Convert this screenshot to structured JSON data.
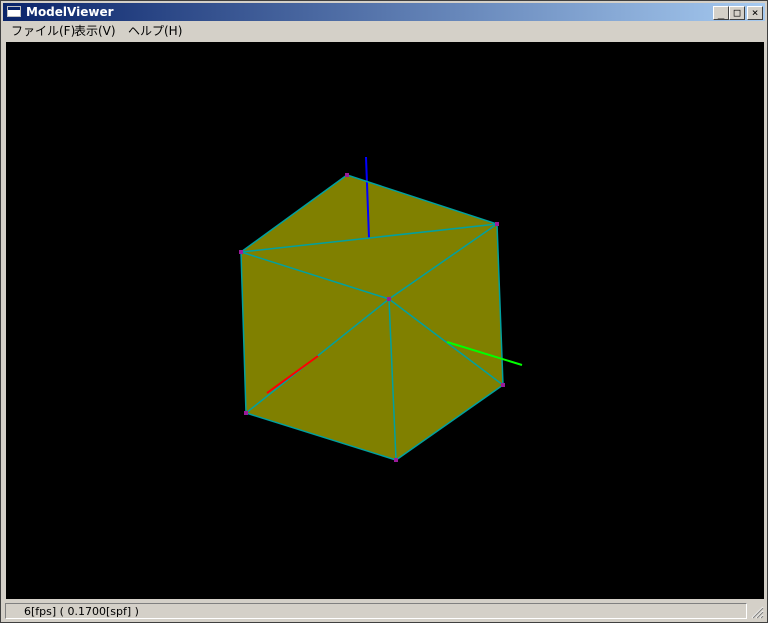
{
  "window": {
    "title": "ModelViewer"
  },
  "controls": {
    "minimize": "_",
    "maximize": "□",
    "close": "×"
  },
  "menu": {
    "file": "ファイル(F)",
    "view": "表示(V)",
    "help": "ヘルプ(H)"
  },
  "viewport": {
    "background": "#000000",
    "face_color": "#808000",
    "edge_color": "#00a0a0",
    "vertex_color": "#9a1a9a",
    "axis_colors": {
      "x": "#ff0000",
      "y": "#00ff00",
      "z": "#0000ff"
    }
  },
  "status": {
    "text": "6[fps] ( 0.1700[spf] )"
  }
}
